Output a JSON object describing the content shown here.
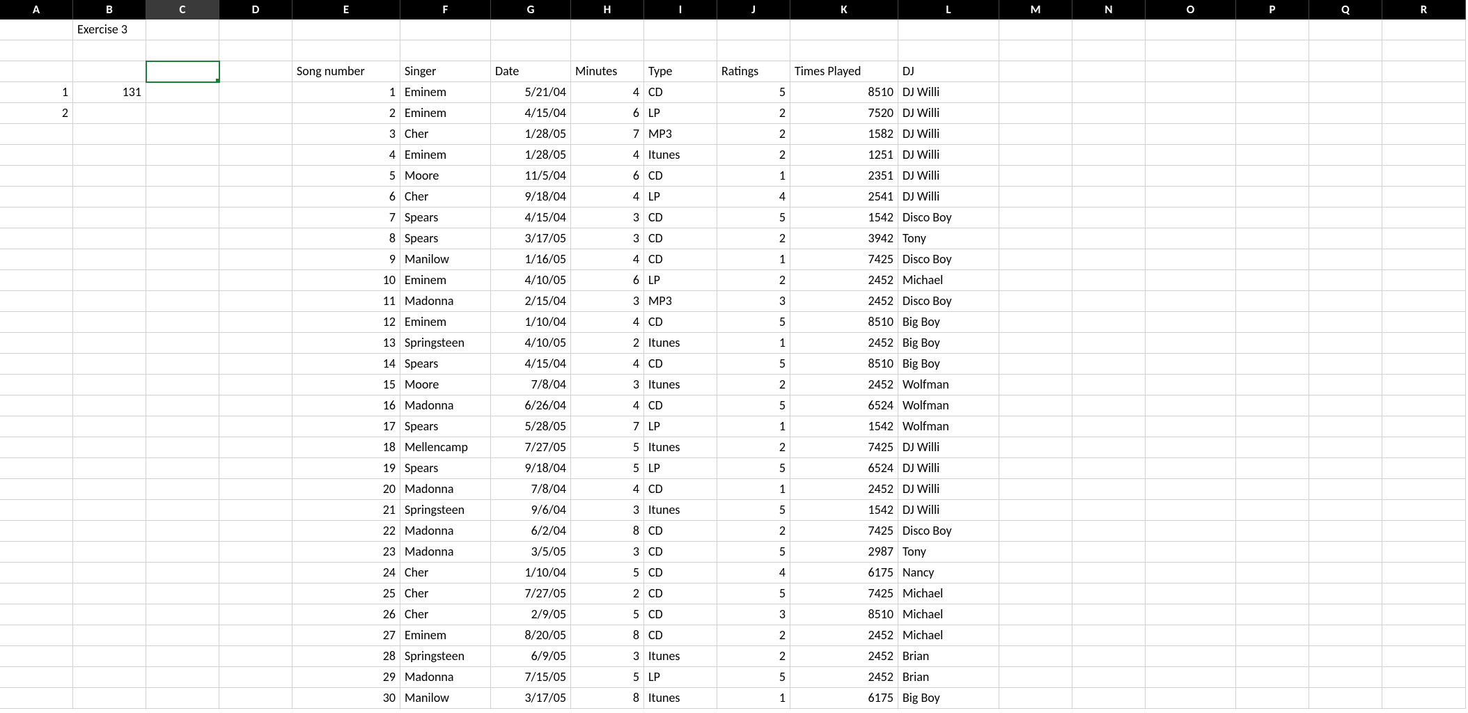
{
  "columns": [
    "A",
    "B",
    "C",
    "D",
    "E",
    "F",
    "G",
    "H",
    "I",
    "J",
    "K",
    "L",
    "M",
    "N",
    "O",
    "P",
    "Q",
    "R"
  ],
  "selected_column": "C",
  "active_cell": {
    "col": "C",
    "row_index": 3
  },
  "left_block": {
    "title": "Exercise 3",
    "nums": [
      {
        "a": 1,
        "b": 131
      },
      {
        "a": 2,
        "b": ""
      }
    ]
  },
  "table": {
    "headers": {
      "song_number": "Song number",
      "singer": "Singer",
      "date": "Date",
      "minutes": "Minutes",
      "type": "Type",
      "ratings": "Ratings",
      "times_played": "Times Played",
      "dj": "DJ"
    },
    "rows": [
      {
        "n": 1,
        "singer": "Eminem",
        "date": "5/21/04",
        "min": 4,
        "type": "CD",
        "rating": 5,
        "played": 8510,
        "dj": "DJ Willi"
      },
      {
        "n": 2,
        "singer": "Eminem",
        "date": "4/15/04",
        "min": 6,
        "type": "LP",
        "rating": 2,
        "played": 7520,
        "dj": "DJ Willi"
      },
      {
        "n": 3,
        "singer": "Cher",
        "date": "1/28/05",
        "min": 7,
        "type": "MP3",
        "rating": 2,
        "played": 1582,
        "dj": "DJ Willi"
      },
      {
        "n": 4,
        "singer": "Eminem",
        "date": "1/28/05",
        "min": 4,
        "type": "Itunes",
        "rating": 2,
        "played": 1251,
        "dj": "DJ Willi"
      },
      {
        "n": 5,
        "singer": "Moore",
        "date": "11/5/04",
        "min": 6,
        "type": "CD",
        "rating": 1,
        "played": 2351,
        "dj": "DJ Willi"
      },
      {
        "n": 6,
        "singer": "Cher",
        "date": "9/18/04",
        "min": 4,
        "type": "LP",
        "rating": 4,
        "played": 2541,
        "dj": "DJ Willi"
      },
      {
        "n": 7,
        "singer": "Spears",
        "date": "4/15/04",
        "min": 3,
        "type": "CD",
        "rating": 5,
        "played": 1542,
        "dj": "Disco Boy"
      },
      {
        "n": 8,
        "singer": "Spears",
        "date": "3/17/05",
        "min": 3,
        "type": "CD",
        "rating": 2,
        "played": 3942,
        "dj": "Tony"
      },
      {
        "n": 9,
        "singer": "Manilow",
        "date": "1/16/05",
        "min": 4,
        "type": "CD",
        "rating": 1,
        "played": 7425,
        "dj": "Disco Boy"
      },
      {
        "n": 10,
        "singer": "Eminem",
        "date": "4/10/05",
        "min": 6,
        "type": "LP",
        "rating": 2,
        "played": 2452,
        "dj": "Michael"
      },
      {
        "n": 11,
        "singer": "Madonna",
        "date": "2/15/04",
        "min": 3,
        "type": "MP3",
        "rating": 3,
        "played": 2452,
        "dj": "Disco Boy"
      },
      {
        "n": 12,
        "singer": "Eminem",
        "date": "1/10/04",
        "min": 4,
        "type": "CD",
        "rating": 5,
        "played": 8510,
        "dj": "Big Boy"
      },
      {
        "n": 13,
        "singer": "Springsteen",
        "date": "4/10/05",
        "min": 2,
        "type": "Itunes",
        "rating": 1,
        "played": 2452,
        "dj": "Big Boy"
      },
      {
        "n": 14,
        "singer": "Spears",
        "date": "4/15/04",
        "min": 4,
        "type": "CD",
        "rating": 5,
        "played": 8510,
        "dj": "Big Boy"
      },
      {
        "n": 15,
        "singer": "Moore",
        "date": "7/8/04",
        "min": 3,
        "type": "Itunes",
        "rating": 2,
        "played": 2452,
        "dj": "Wolfman"
      },
      {
        "n": 16,
        "singer": "Madonna",
        "date": "6/26/04",
        "min": 4,
        "type": "CD",
        "rating": 5,
        "played": 6524,
        "dj": "Wolfman"
      },
      {
        "n": 17,
        "singer": "Spears",
        "date": "5/28/05",
        "min": 7,
        "type": "LP",
        "rating": 1,
        "played": 1542,
        "dj": "Wolfman"
      },
      {
        "n": 18,
        "singer": "Mellencamp",
        "date": "7/27/05",
        "min": 5,
        "type": "Itunes",
        "rating": 2,
        "played": 7425,
        "dj": "DJ Willi"
      },
      {
        "n": 19,
        "singer": "Spears",
        "date": "9/18/04",
        "min": 5,
        "type": "LP",
        "rating": 5,
        "played": 6524,
        "dj": "DJ Willi"
      },
      {
        "n": 20,
        "singer": "Madonna",
        "date": "7/8/04",
        "min": 4,
        "type": "CD",
        "rating": 1,
        "played": 2452,
        "dj": "DJ Willi"
      },
      {
        "n": 21,
        "singer": "Springsteen",
        "date": "9/6/04",
        "min": 3,
        "type": "Itunes",
        "rating": 5,
        "played": 1542,
        "dj": "DJ Willi"
      },
      {
        "n": 22,
        "singer": "Madonna",
        "date": "6/2/04",
        "min": 8,
        "type": "CD",
        "rating": 2,
        "played": 7425,
        "dj": "Disco Boy"
      },
      {
        "n": 23,
        "singer": "Madonna",
        "date": "3/5/05",
        "min": 3,
        "type": "CD",
        "rating": 5,
        "played": 2987,
        "dj": "Tony"
      },
      {
        "n": 24,
        "singer": "Cher",
        "date": "1/10/04",
        "min": 5,
        "type": "CD",
        "rating": 4,
        "played": 6175,
        "dj": "Nancy"
      },
      {
        "n": 25,
        "singer": "Cher",
        "date": "7/27/05",
        "min": 2,
        "type": "CD",
        "rating": 5,
        "played": 7425,
        "dj": "Michael"
      },
      {
        "n": 26,
        "singer": "Cher",
        "date": "2/9/05",
        "min": 5,
        "type": "CD",
        "rating": 3,
        "played": 8510,
        "dj": "Michael"
      },
      {
        "n": 27,
        "singer": "Eminem",
        "date": "8/20/05",
        "min": 8,
        "type": "CD",
        "rating": 2,
        "played": 2452,
        "dj": "Michael"
      },
      {
        "n": 28,
        "singer": "Springsteen",
        "date": "6/9/05",
        "min": 3,
        "type": "Itunes",
        "rating": 2,
        "played": 2452,
        "dj": "Brian"
      },
      {
        "n": 29,
        "singer": "Madonna",
        "date": "7/15/05",
        "min": 5,
        "type": "LP",
        "rating": 5,
        "played": 2452,
        "dj": "Brian"
      },
      {
        "n": 30,
        "singer": "Manilow",
        "date": "3/17/05",
        "min": 8,
        "type": "Itunes",
        "rating": 1,
        "played": 6175,
        "dj": "Big Boy"
      }
    ]
  }
}
